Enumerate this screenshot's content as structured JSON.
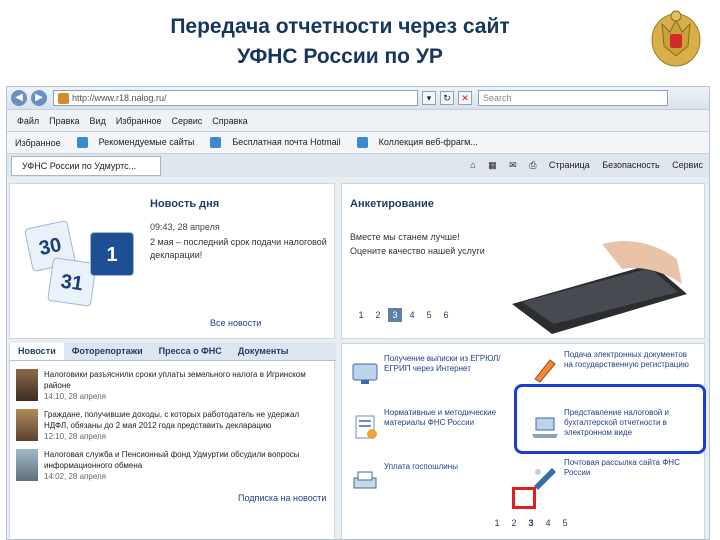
{
  "slide": {
    "title_line1": "Передача отчетности через сайт",
    "title_line2": "УФНС России по УР"
  },
  "browser": {
    "url": "http://www.r18.nalog.ru/",
    "search_placeholder": "Search",
    "menu": [
      "Файл",
      "Правка",
      "Вид",
      "Избранное",
      "Сервис",
      "Справка"
    ],
    "favorites_label": "Избранное",
    "favorites": [
      "Рекомендуемые сайты",
      "Бесплатная почта Hotmail",
      "Коллекция веб-фрагм..."
    ],
    "active_tab": "УФНС России по Удмуртс...",
    "tools": [
      "Страница",
      "Безопасность",
      "Сервис"
    ]
  },
  "news_of_day": {
    "heading": "Новость дня",
    "date": "09:43, 28 апреля",
    "text": "2 мая – последний срок подачи налоговой декларации!",
    "all_news": "Все новости",
    "calendar_numbers": [
      "30",
      "31",
      "1"
    ]
  },
  "survey": {
    "heading": "Анкетирование",
    "line1": "Вместе мы станем лучше!",
    "line2": "Оцените качество нашей услуги",
    "pages": [
      "1",
      "2",
      "3",
      "4",
      "5",
      "6"
    ],
    "current_page": "3"
  },
  "tabs": [
    "Новости",
    "Фоторепортажи",
    "Пресса о ФНС",
    "Документы"
  ],
  "news_list": [
    {
      "text": "Налоговики разъяснили сроки уплаты земельного налога в Игринском районе",
      "date": "14:10, 28 апреля"
    },
    {
      "text": "Граждане, получившие доходы, с которых работодатель не удержал НДФЛ, обязаны до 2 мая 2012 года представить декларацию",
      "date": "12:10, 28 апреля"
    },
    {
      "text": "Налоговая служба и Пенсионный фонд Удмуртии обсудили вопросы информационного обмена",
      "date": "14:02, 28 апреля"
    }
  ],
  "subscribe_news": "Подписка на новости",
  "services": [
    {
      "text": "Получение выписки из ЕГРЮЛ/ЕГРИП через Интернет"
    },
    {
      "text": "Подача электронных документов на государственную регистрацию"
    },
    {
      "text": "Нормативные и методические материалы ФНС России"
    },
    {
      "text": "Представление налоговой и бухгалтерской отчетности в электронном виде"
    },
    {
      "text": "Уплата госпошлины"
    },
    {
      "text": "Почтовая рассылка сайта ФНС России"
    }
  ],
  "service_pages": [
    "1",
    "2",
    "3",
    "4",
    "5"
  ],
  "colors": {
    "title": "#17365d",
    "highlight_box": "#1a3fd0",
    "highlight_page": "#e0201a"
  }
}
